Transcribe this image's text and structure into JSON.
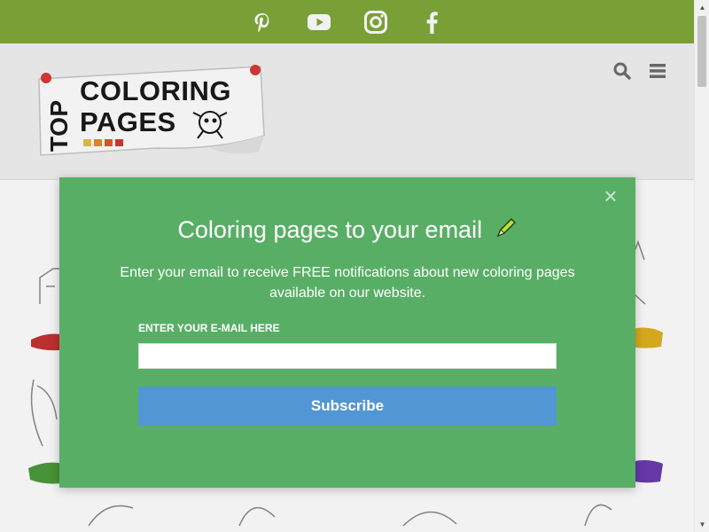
{
  "social": {
    "icons": [
      "pinterest-icon",
      "youtube-icon",
      "instagram-icon",
      "facebook-icon"
    ],
    "bar_color": "#80a83a"
  },
  "header": {
    "logo": {
      "line1": "TOP",
      "line2": "COLORING",
      "line3": "PAGES"
    },
    "icons": [
      "search-icon",
      "menu-icon"
    ]
  },
  "modal": {
    "title": "Coloring pages to your email",
    "description": "Enter your email to receive FREE notifications about new coloring pages available on our website.",
    "email_label": "ENTER YOUR E-MAIL HERE",
    "email_value": "",
    "email_placeholder": "",
    "subscribe_label": "Subscribe",
    "close_label": "×",
    "background_color": "#59ae66",
    "button_color": "#5296d3"
  }
}
